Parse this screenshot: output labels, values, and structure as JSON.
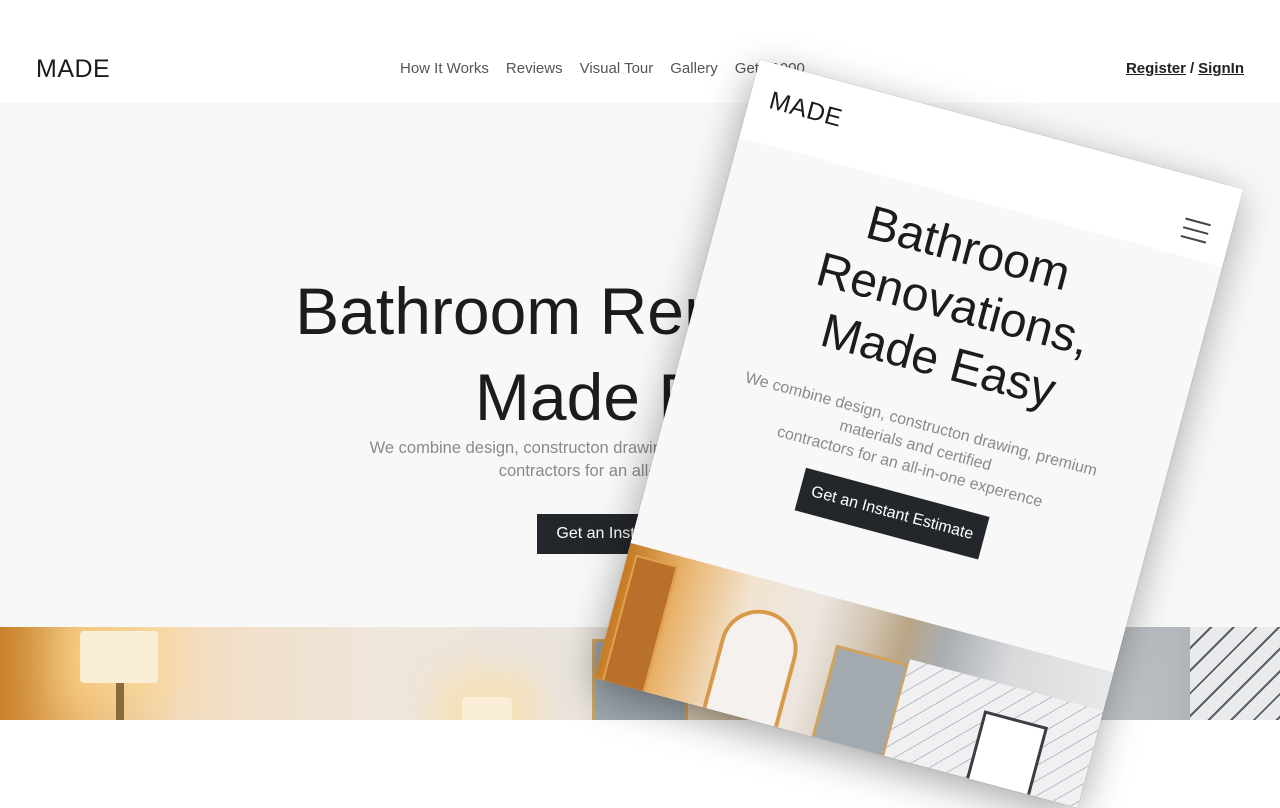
{
  "desktop": {
    "logo": "MADE",
    "nav": [
      "How It Works",
      "Reviews",
      "Visual Tour",
      "Gallery",
      "Get $1000"
    ],
    "auth": {
      "register": "Register",
      "separator": "/",
      "signin": "SignIn"
    },
    "hero": {
      "title_line1": "Bathroom Renovations,",
      "title_line2": "Made Easy",
      "subtitle_line1": "We combine design, constructon drawing, premium materials and certified",
      "subtitle_line2": "contractors for an all-in-one experence",
      "cta": "Get an Instant Estimate"
    }
  },
  "mobile": {
    "logo": "MADE",
    "menu_icon": "hamburger-menu-icon",
    "hero": {
      "title_line1": "Bathroom",
      "title_line2": "Renovations,",
      "title_line3": "Made Easy",
      "subtitle_line1": "We combine design, constructon drawing, premium",
      "subtitle_line2": "materials and certified",
      "subtitle_line3": "contractors for an all-in-one experence",
      "cta": "Get an Instant Estimate"
    }
  },
  "colors": {
    "cta_background": "#23262b",
    "hero_background": "#f8f8f8",
    "text_dark": "#1c1c1c",
    "text_muted": "#8a8a8a"
  }
}
